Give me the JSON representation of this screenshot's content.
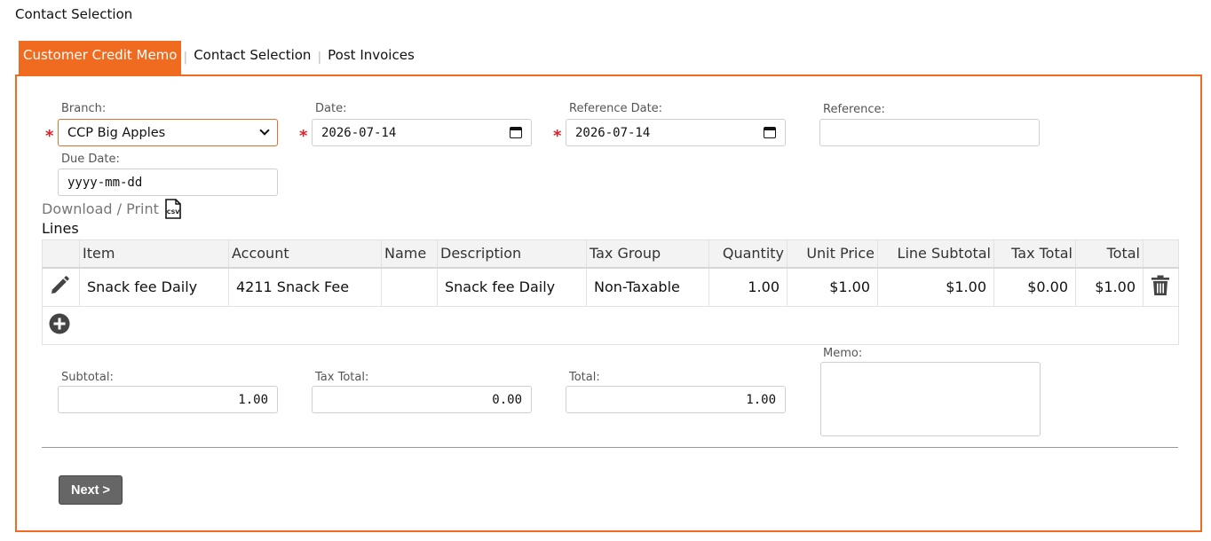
{
  "page_title": "Contact Selection",
  "tabs": [
    {
      "label": "Customer Credit Memo",
      "active": true
    },
    {
      "label": "Contact Selection",
      "active": false
    },
    {
      "label": "Post Invoices",
      "active": false
    }
  ],
  "form": {
    "branch": {
      "label": "Branch:",
      "value": "CCP Big Apples",
      "required": true
    },
    "date": {
      "label": "Date:",
      "value": "2026-07-14",
      "required": true
    },
    "reference_date": {
      "label": "Reference Date:",
      "value": "2026-07-14",
      "required": true
    },
    "reference": {
      "label": "Reference:",
      "value": ""
    },
    "due_date": {
      "label": "Due Date:",
      "placeholder": "yyyy-mm-dd"
    },
    "required_mark": "*"
  },
  "download": {
    "label": "Download / Print",
    "icon": "csv-file-icon",
    "icon_text": "CSV"
  },
  "lines": {
    "label": "Lines",
    "columns": [
      "Item",
      "Account",
      "Name",
      "Description",
      "Tax Group",
      "Quantity",
      "Unit Price",
      "Line Subtotal",
      "Tax Total",
      "Total"
    ],
    "rows": [
      {
        "item": "Snack fee Daily",
        "account": "4211 Snack Fee",
        "name": "",
        "description": "Snack fee Daily",
        "tax_group": "Non-Taxable",
        "quantity": "1.00",
        "unit_price": "$1.00",
        "line_subtotal": "$1.00",
        "tax_total": "$0.00",
        "total": "$1.00"
      }
    ]
  },
  "totals": {
    "subtotal": {
      "label": "Subtotal:",
      "value": "1.00"
    },
    "tax_total": {
      "label": "Tax Total:",
      "value": "0.00"
    },
    "total": {
      "label": "Total:",
      "value": "1.00"
    },
    "memo": {
      "label": "Memo:",
      "value": ""
    }
  },
  "next_button": "Next >",
  "colors": {
    "accent": "#f06b1f",
    "required": "#e0202a",
    "button": "#666666"
  }
}
